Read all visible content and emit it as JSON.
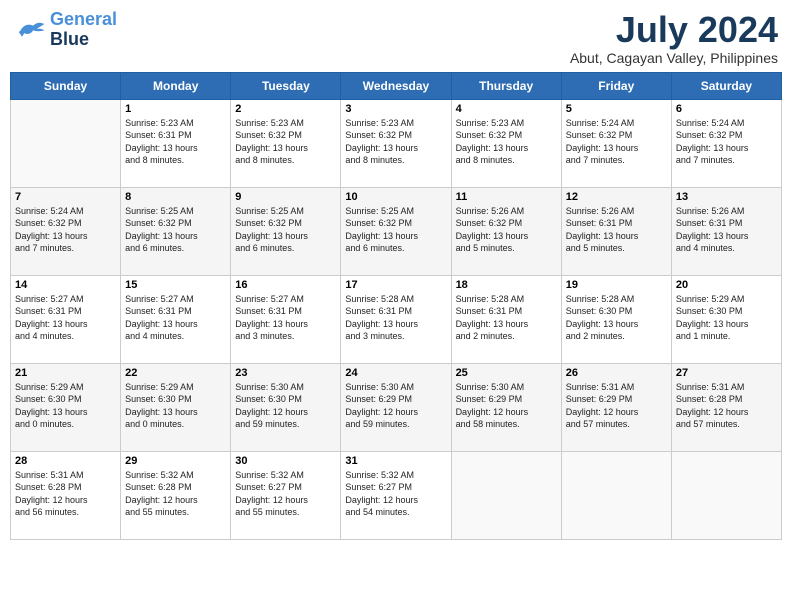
{
  "header": {
    "logo_line1": "General",
    "logo_line2": "Blue",
    "month_title": "July 2024",
    "location": "Abut, Cagayan Valley, Philippines"
  },
  "days_of_week": [
    "Sunday",
    "Monday",
    "Tuesday",
    "Wednesday",
    "Thursday",
    "Friday",
    "Saturday"
  ],
  "weeks": [
    [
      {
        "day": "",
        "info": ""
      },
      {
        "day": "1",
        "info": "Sunrise: 5:23 AM\nSunset: 6:31 PM\nDaylight: 13 hours\nand 8 minutes."
      },
      {
        "day": "2",
        "info": "Sunrise: 5:23 AM\nSunset: 6:32 PM\nDaylight: 13 hours\nand 8 minutes."
      },
      {
        "day": "3",
        "info": "Sunrise: 5:23 AM\nSunset: 6:32 PM\nDaylight: 13 hours\nand 8 minutes."
      },
      {
        "day": "4",
        "info": "Sunrise: 5:23 AM\nSunset: 6:32 PM\nDaylight: 13 hours\nand 8 minutes."
      },
      {
        "day": "5",
        "info": "Sunrise: 5:24 AM\nSunset: 6:32 PM\nDaylight: 13 hours\nand 7 minutes."
      },
      {
        "day": "6",
        "info": "Sunrise: 5:24 AM\nSunset: 6:32 PM\nDaylight: 13 hours\nand 7 minutes."
      }
    ],
    [
      {
        "day": "7",
        "info": "Sunrise: 5:24 AM\nSunset: 6:32 PM\nDaylight: 13 hours\nand 7 minutes."
      },
      {
        "day": "8",
        "info": "Sunrise: 5:25 AM\nSunset: 6:32 PM\nDaylight: 13 hours\nand 6 minutes."
      },
      {
        "day": "9",
        "info": "Sunrise: 5:25 AM\nSunset: 6:32 PM\nDaylight: 13 hours\nand 6 minutes."
      },
      {
        "day": "10",
        "info": "Sunrise: 5:25 AM\nSunset: 6:32 PM\nDaylight: 13 hours\nand 6 minutes."
      },
      {
        "day": "11",
        "info": "Sunrise: 5:26 AM\nSunset: 6:32 PM\nDaylight: 13 hours\nand 5 minutes."
      },
      {
        "day": "12",
        "info": "Sunrise: 5:26 AM\nSunset: 6:31 PM\nDaylight: 13 hours\nand 5 minutes."
      },
      {
        "day": "13",
        "info": "Sunrise: 5:26 AM\nSunset: 6:31 PM\nDaylight: 13 hours\nand 4 minutes."
      }
    ],
    [
      {
        "day": "14",
        "info": "Sunrise: 5:27 AM\nSunset: 6:31 PM\nDaylight: 13 hours\nand 4 minutes."
      },
      {
        "day": "15",
        "info": "Sunrise: 5:27 AM\nSunset: 6:31 PM\nDaylight: 13 hours\nand 4 minutes."
      },
      {
        "day": "16",
        "info": "Sunrise: 5:27 AM\nSunset: 6:31 PM\nDaylight: 13 hours\nand 3 minutes."
      },
      {
        "day": "17",
        "info": "Sunrise: 5:28 AM\nSunset: 6:31 PM\nDaylight: 13 hours\nand 3 minutes."
      },
      {
        "day": "18",
        "info": "Sunrise: 5:28 AM\nSunset: 6:31 PM\nDaylight: 13 hours\nand 2 minutes."
      },
      {
        "day": "19",
        "info": "Sunrise: 5:28 AM\nSunset: 6:30 PM\nDaylight: 13 hours\nand 2 minutes."
      },
      {
        "day": "20",
        "info": "Sunrise: 5:29 AM\nSunset: 6:30 PM\nDaylight: 13 hours\nand 1 minute."
      }
    ],
    [
      {
        "day": "21",
        "info": "Sunrise: 5:29 AM\nSunset: 6:30 PM\nDaylight: 13 hours\nand 0 minutes."
      },
      {
        "day": "22",
        "info": "Sunrise: 5:29 AM\nSunset: 6:30 PM\nDaylight: 13 hours\nand 0 minutes."
      },
      {
        "day": "23",
        "info": "Sunrise: 5:30 AM\nSunset: 6:30 PM\nDaylight: 12 hours\nand 59 minutes."
      },
      {
        "day": "24",
        "info": "Sunrise: 5:30 AM\nSunset: 6:29 PM\nDaylight: 12 hours\nand 59 minutes."
      },
      {
        "day": "25",
        "info": "Sunrise: 5:30 AM\nSunset: 6:29 PM\nDaylight: 12 hours\nand 58 minutes."
      },
      {
        "day": "26",
        "info": "Sunrise: 5:31 AM\nSunset: 6:29 PM\nDaylight: 12 hours\nand 57 minutes."
      },
      {
        "day": "27",
        "info": "Sunrise: 5:31 AM\nSunset: 6:28 PM\nDaylight: 12 hours\nand 57 minutes."
      }
    ],
    [
      {
        "day": "28",
        "info": "Sunrise: 5:31 AM\nSunset: 6:28 PM\nDaylight: 12 hours\nand 56 minutes."
      },
      {
        "day": "29",
        "info": "Sunrise: 5:32 AM\nSunset: 6:28 PM\nDaylight: 12 hours\nand 55 minutes."
      },
      {
        "day": "30",
        "info": "Sunrise: 5:32 AM\nSunset: 6:27 PM\nDaylight: 12 hours\nand 55 minutes."
      },
      {
        "day": "31",
        "info": "Sunrise: 5:32 AM\nSunset: 6:27 PM\nDaylight: 12 hours\nand 54 minutes."
      },
      {
        "day": "",
        "info": ""
      },
      {
        "day": "",
        "info": ""
      },
      {
        "day": "",
        "info": ""
      }
    ]
  ]
}
